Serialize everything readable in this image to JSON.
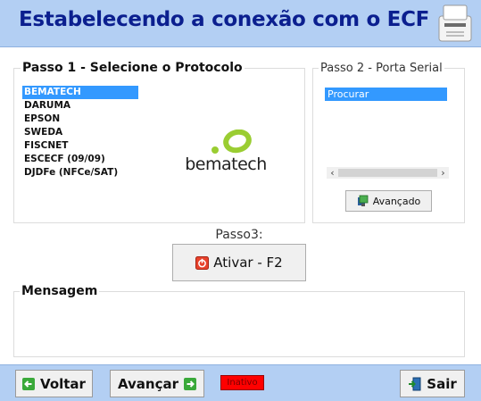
{
  "header": {
    "title": "Estabelecendo a conexão com o ECF",
    "icon": "printer-icon"
  },
  "step1": {
    "legend": "Passo 1 - Selecione o Protocolo",
    "protocols": [
      "BEMATECH",
      "DARUMA",
      "EPSON",
      "SWEDA",
      "FISCNET",
      "ESCECF (09/09)",
      "DJDFe (NFCe/SAT)"
    ],
    "selected": "BEMATECH",
    "logo_text": "bematech",
    "logo_color": "#9acd32"
  },
  "step2": {
    "legend": "Passo 2 - Porta Serial",
    "ports": [
      "Procurar"
    ],
    "advanced_label": "Avançado",
    "advanced_icon": "settings-icon"
  },
  "step3": {
    "label": "Passo3:",
    "activate_label": "Ativar - F2",
    "activate_icon": "power-icon"
  },
  "message": {
    "legend": "Mensagem",
    "text": ""
  },
  "footer": {
    "back_label": "Voltar",
    "back_icon": "arrow-left-icon",
    "next_label": "Avançar",
    "next_icon": "arrow-right-icon",
    "status": "Inativo",
    "status_color": "#ff0000",
    "exit_label": "Sair",
    "exit_icon": "exit-door-icon"
  },
  "colors": {
    "header_bg": "#b3cff3",
    "title": "#0b1f8f",
    "selection": "#3399ff"
  }
}
